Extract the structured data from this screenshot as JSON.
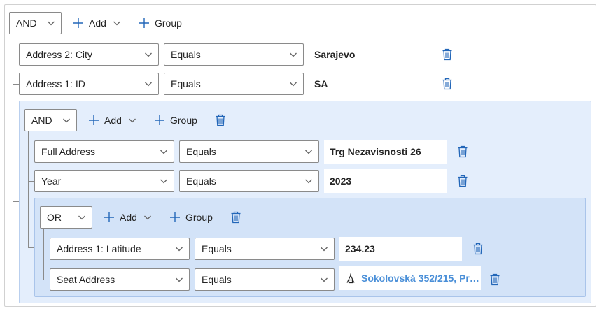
{
  "root": {
    "operator": "AND",
    "add_label": "Add",
    "group_label": "Group",
    "rows": [
      {
        "field": "Address 2: City",
        "operator": "Equals",
        "value": "Sarajevo"
      },
      {
        "field": "Address 1: ID",
        "operator": "Equals",
        "value": "SA"
      }
    ]
  },
  "group1": {
    "operator": "AND",
    "add_label": "Add",
    "group_label": "Group",
    "rows": [
      {
        "field": "Full Address",
        "operator": "Equals",
        "value": "Trg Nezavisnosti 26"
      },
      {
        "field": "Year",
        "operator": "Equals",
        "value": "2023"
      }
    ]
  },
  "group2": {
    "operator": "OR",
    "add_label": "Add",
    "group_label": "Group",
    "rows": [
      {
        "field": "Address 1: Latitude",
        "operator": "Equals",
        "value": "234.23"
      },
      {
        "field": "Seat Address",
        "operator": "Equals",
        "value": "Sokolovská 352/215, Prah..."
      }
    ]
  },
  "icons": {
    "add": "plus-icon",
    "dropdown": "chevron-down-icon",
    "delete": "trash-icon",
    "lookup": "entity-icon"
  },
  "colors": {
    "accent": "#2266b8",
    "link": "#4a8fd8",
    "group1_bg": "#e4eefc",
    "group2_bg": "#d3e3f8"
  }
}
